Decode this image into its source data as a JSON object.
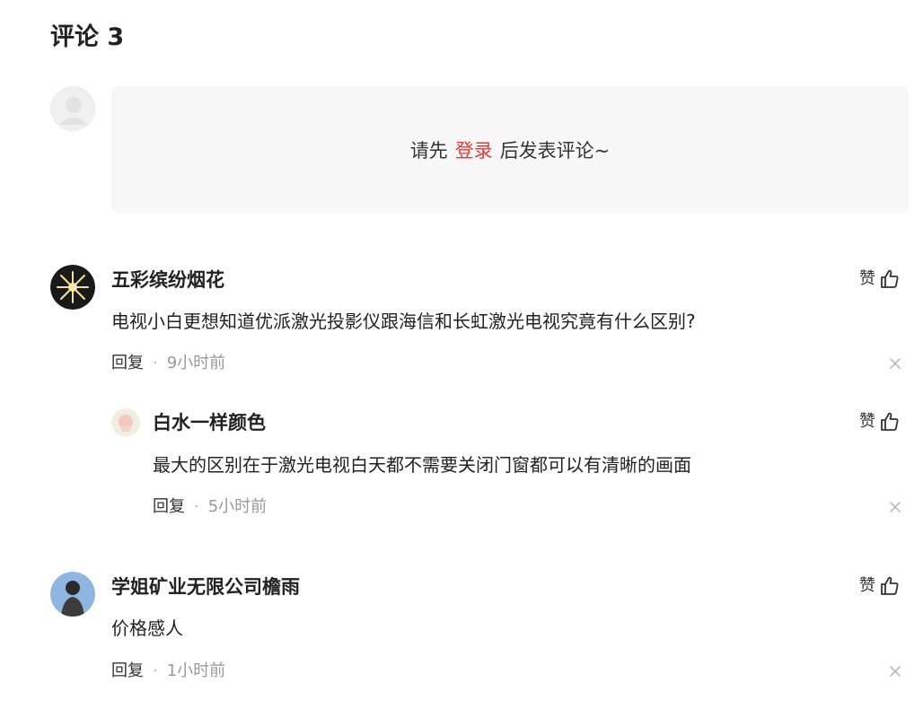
{
  "header": {
    "title": "评论 3"
  },
  "composer": {
    "prefix": "请先",
    "login_link": "登录",
    "suffix": "后发表评论~"
  },
  "comments": [
    {
      "author": "五彩缤纷烟花",
      "text": "电视小白更想知道优派激光投影仪跟海信和长虹激光电视究竟有什么区别?",
      "reply_label": "回复",
      "dot": "·",
      "time": "9小时前",
      "like_label": "赞"
    },
    {
      "author": "白水一样颜色",
      "text": "最大的区别在于激光电视白天都不需要关闭门窗都可以有清晰的画面",
      "reply_label": "回复",
      "dot": "·",
      "time": "5小时前",
      "like_label": "赞"
    },
    {
      "author": "学姐矿业无限公司檐雨",
      "text": "价格感人",
      "reply_label": "回复",
      "dot": "·",
      "time": "1小时前",
      "like_label": "赞"
    }
  ],
  "colors": {
    "accent": "#e33b3b",
    "muted": "#999999",
    "panel": "#f7f7f7"
  },
  "icons": [
    "default-avatar-icon",
    "thumbs-up-icon",
    "close-icon"
  ]
}
